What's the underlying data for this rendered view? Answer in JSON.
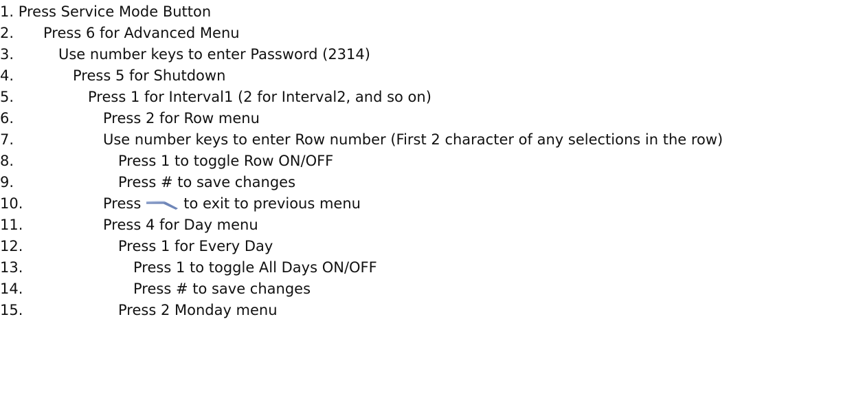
{
  "steps": [
    {
      "text": "1. Press Service Mode Button"
    },
    {
      "num": "2.",
      "text": "Press 6 for Advanced Menu"
    },
    {
      "num": "3.",
      "text": "Use number keys to enter Password (2314)"
    },
    {
      "num": "4.",
      "text": "Press 5 for Shutdown"
    },
    {
      "num": "5.",
      "text": "Press 1 for Interval1 (2 for Interval2, and so on)"
    },
    {
      "num": "6.",
      "text": "Press 2 for Row menu"
    },
    {
      "num": "7.",
      "text": "Use number keys to enter Row number (First 2 character of any selections in the row)"
    },
    {
      "num": "8.",
      "text": "Press 1 to toggle Row ON/OFF"
    },
    {
      "num": "9.",
      "text": "Press # to save changes"
    },
    {
      "num": "10.",
      "text_before": "Press",
      "icon": "back-arrow-icon",
      "text_after": "to exit to previous menu"
    },
    {
      "num": "11.",
      "text": "Press 4 for Day menu"
    },
    {
      "num": "12.",
      "text": "Press 1 for Every Day"
    },
    {
      "num": "13.",
      "text": "Press 1 to toggle All Days ON/OFF"
    },
    {
      "num": "14.",
      "text": "Press # to save changes"
    },
    {
      "num": "15.",
      "text": "Press 2 Monday menu"
    }
  ],
  "colors": {
    "text": "#111111",
    "icon": "#6f86b8"
  }
}
